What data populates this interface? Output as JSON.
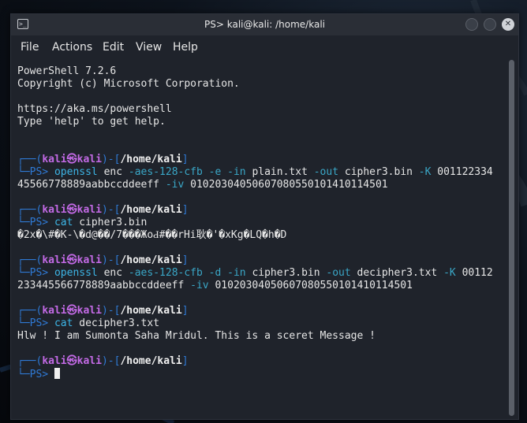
{
  "window": {
    "title": "PS> kali@kali: /home/kali",
    "icon": "terminal-icon"
  },
  "menu": [
    "File",
    "Actions",
    "Edit",
    "View",
    "Help"
  ],
  "terminal": {
    "banner": [
      "PowerShell 7.2.6",
      "Copyright (c) Microsoft Corporation.",
      "",
      "https://aka.ms/powershell",
      "Type 'help' to get help."
    ],
    "prompt": {
      "corner_top": "┌──(",
      "user": "kali",
      "at": "㉿",
      "host": "kali",
      "sep": ")-[",
      "path": "/home/kali",
      "close": "]",
      "corner_bottom": "└─",
      "ps": "PS>"
    },
    "blocks": [
      {
        "cmd": "openssl",
        "args": [
          {
            "t": "enc",
            "k": "plain"
          },
          {
            "t": "-aes-128-cfb",
            "k": "opt"
          },
          {
            "t": "-e",
            "k": "opt"
          },
          {
            "t": "-in",
            "k": "opt"
          },
          {
            "t": "plain.txt",
            "k": "plain"
          },
          {
            "t": "-out",
            "k": "opt"
          },
          {
            "t": "cipher3.bin",
            "k": "plain"
          },
          {
            "t": "-K",
            "k": "opt"
          },
          {
            "t": "001122334",
            "k": "plain"
          }
        ],
        "wrap": [
          {
            "t": "45566778889aabbccddeeff",
            "k": "plain"
          },
          {
            "t": "-iv",
            "k": "opt"
          },
          {
            "t": "01020304050607080550101410114501",
            "k": "plain"
          }
        ],
        "output": []
      },
      {
        "cmd": "cat",
        "args": [
          {
            "t": "cipher3.bin",
            "k": "plain"
          }
        ],
        "wrap": [],
        "output": [
          "�2x�\\#�K-\\�d@��/7���ЖоԀ#��rHi耿�'�xKg�LQ�h�D"
        ]
      },
      {
        "cmd": "openssl",
        "args": [
          {
            "t": "enc",
            "k": "plain"
          },
          {
            "t": "-aes-128-cfb",
            "k": "opt"
          },
          {
            "t": "-d",
            "k": "opt"
          },
          {
            "t": "-in",
            "k": "opt"
          },
          {
            "t": "cipher3.bin",
            "k": "plain"
          },
          {
            "t": "-out",
            "k": "opt"
          },
          {
            "t": "decipher3.txt",
            "k": "plain"
          },
          {
            "t": "-K",
            "k": "opt"
          },
          {
            "t": "00112",
            "k": "plain"
          }
        ],
        "wrap": [
          {
            "t": "233445566778889aabbccddeeff",
            "k": "plain"
          },
          {
            "t": "-iv",
            "k": "opt"
          },
          {
            "t": "01020304050607080550101410114501",
            "k": "plain"
          }
        ],
        "output": []
      },
      {
        "cmd": "cat",
        "args": [
          {
            "t": "decipher3.txt",
            "k": "plain"
          }
        ],
        "wrap": [],
        "output": [
          "Hlw ! I am Sumonta Saha Mridul. This is a sceret Message !"
        ]
      }
    ]
  },
  "colors": {
    "prompt_frame": "#2f7ad6",
    "user_host": "#c36ae6",
    "command": "#3db5e6",
    "option": "#3aa7c7",
    "text": "#e6e6e6",
    "background": "#1f232b"
  }
}
